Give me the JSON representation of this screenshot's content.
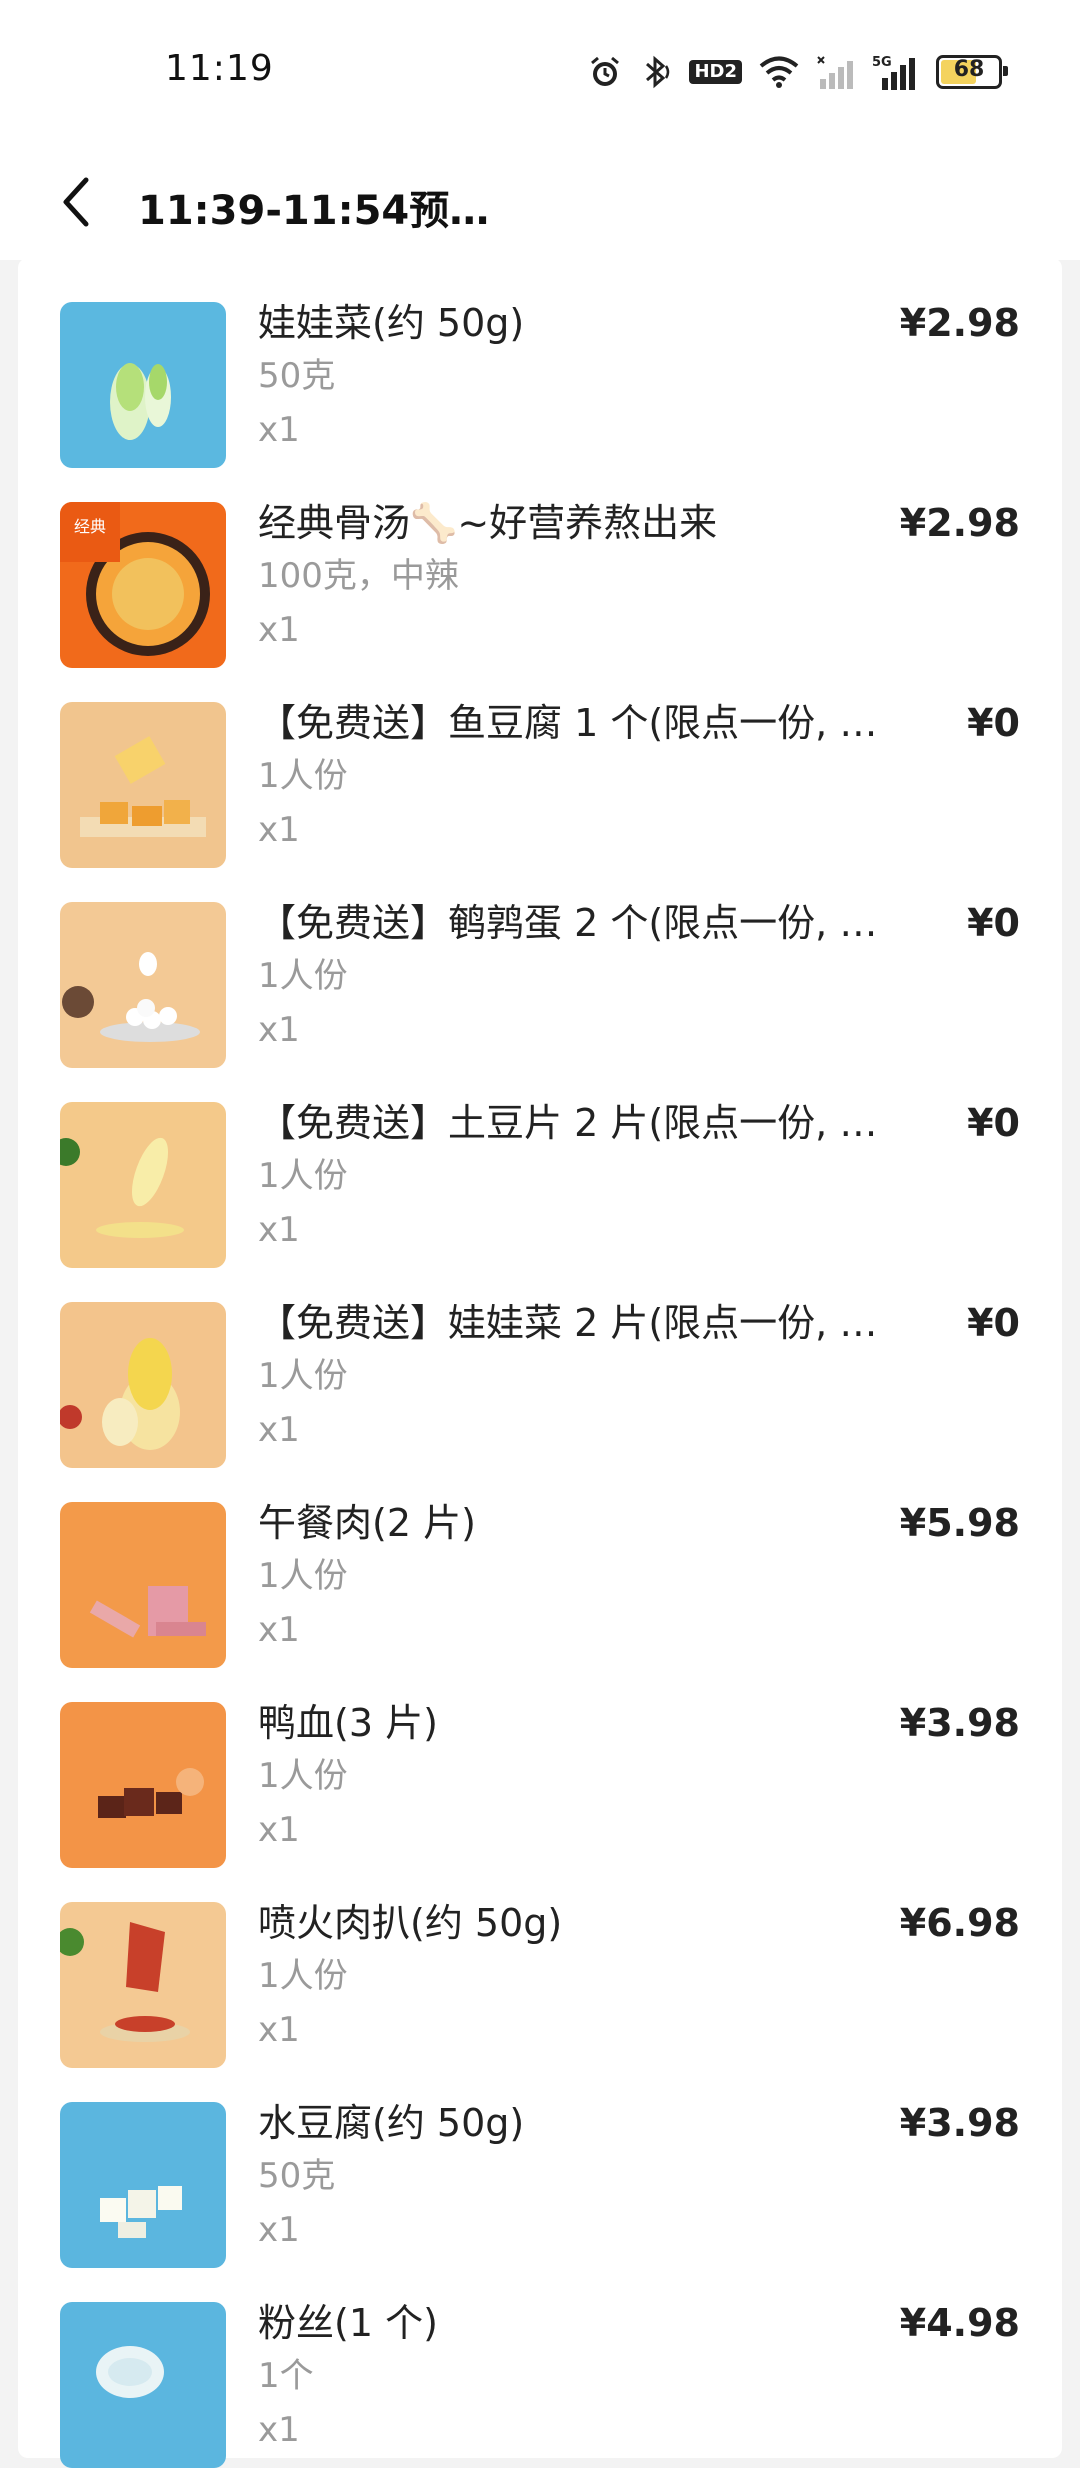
{
  "status_bar": {
    "time": "11:19",
    "battery_level": "68",
    "icons": [
      "alarm-icon",
      "bluetooth-icon",
      "hd-icon",
      "wifi-icon",
      "signal-1-icon",
      "signal-5g-icon",
      "battery-icon"
    ],
    "hd_label": "HD2",
    "network_label": "5G"
  },
  "header": {
    "back_icon": "chevron-left-icon",
    "title": "11:39-11:54预…"
  },
  "items": [
    {
      "name": "娃娃菜(约 50g)",
      "spec": "50克",
      "qty": "x1",
      "price": "¥2.98",
      "thumb": "cabbage",
      "thumb_color": "#5bb8e0"
    },
    {
      "name": "经典骨汤🦴~好营养熬出来",
      "spec": "100克，中辣",
      "qty": "x1",
      "price": "¥2.98",
      "thumb": "soup",
      "thumb_color": "#f16a1b"
    },
    {
      "name": "【免费送】鱼豆腐 1 个(限点一份, 多点…",
      "spec": "1人份",
      "qty": "x1",
      "price": "¥0",
      "thumb": "fish-tofu",
      "thumb_color": "#f1c58e"
    },
    {
      "name": "【免费送】鹌鹑蛋 2 个(限点一份, 多点…",
      "spec": "1人份",
      "qty": "x1",
      "price": "¥0",
      "thumb": "quail-egg",
      "thumb_color": "#f3c995"
    },
    {
      "name": "【免费送】土豆片 2 片(限点一份, 多点…",
      "spec": "1人份",
      "qty": "x1",
      "price": "¥0",
      "thumb": "potato",
      "thumb_color": "#f4c98a"
    },
    {
      "name": "【免费送】娃娃菜 2 片(限点一份, 多点…",
      "spec": "1人份",
      "qty": "x1",
      "price": "¥0",
      "thumb": "cabbage-yellow",
      "thumb_color": "#f3c48c"
    },
    {
      "name": "午餐肉(2 片)",
      "spec": "1人份",
      "qty": "x1",
      "price": "¥5.98",
      "thumb": "luncheon-meat",
      "thumb_color": "#f39a4a"
    },
    {
      "name": "鸭血(3 片)",
      "spec": "1人份",
      "qty": "x1",
      "price": "¥3.98",
      "thumb": "duck-blood",
      "thumb_color": "#f39447"
    },
    {
      "name": "喷火肉扒(约 50g)",
      "spec": "1人份",
      "qty": "x1",
      "price": "¥6.98",
      "thumb": "meat-steak",
      "thumb_color": "#f4c993"
    },
    {
      "name": "水豆腐(约 50g)",
      "spec": "50克",
      "qty": "x1",
      "price": "¥3.98",
      "thumb": "tofu",
      "thumb_color": "#5bb6df"
    },
    {
      "name": "粉丝(1 个)",
      "spec": "1个",
      "qty": "x1",
      "price": "¥4.98",
      "thumb": "vermicelli",
      "thumb_color": "#5bb6df"
    }
  ]
}
